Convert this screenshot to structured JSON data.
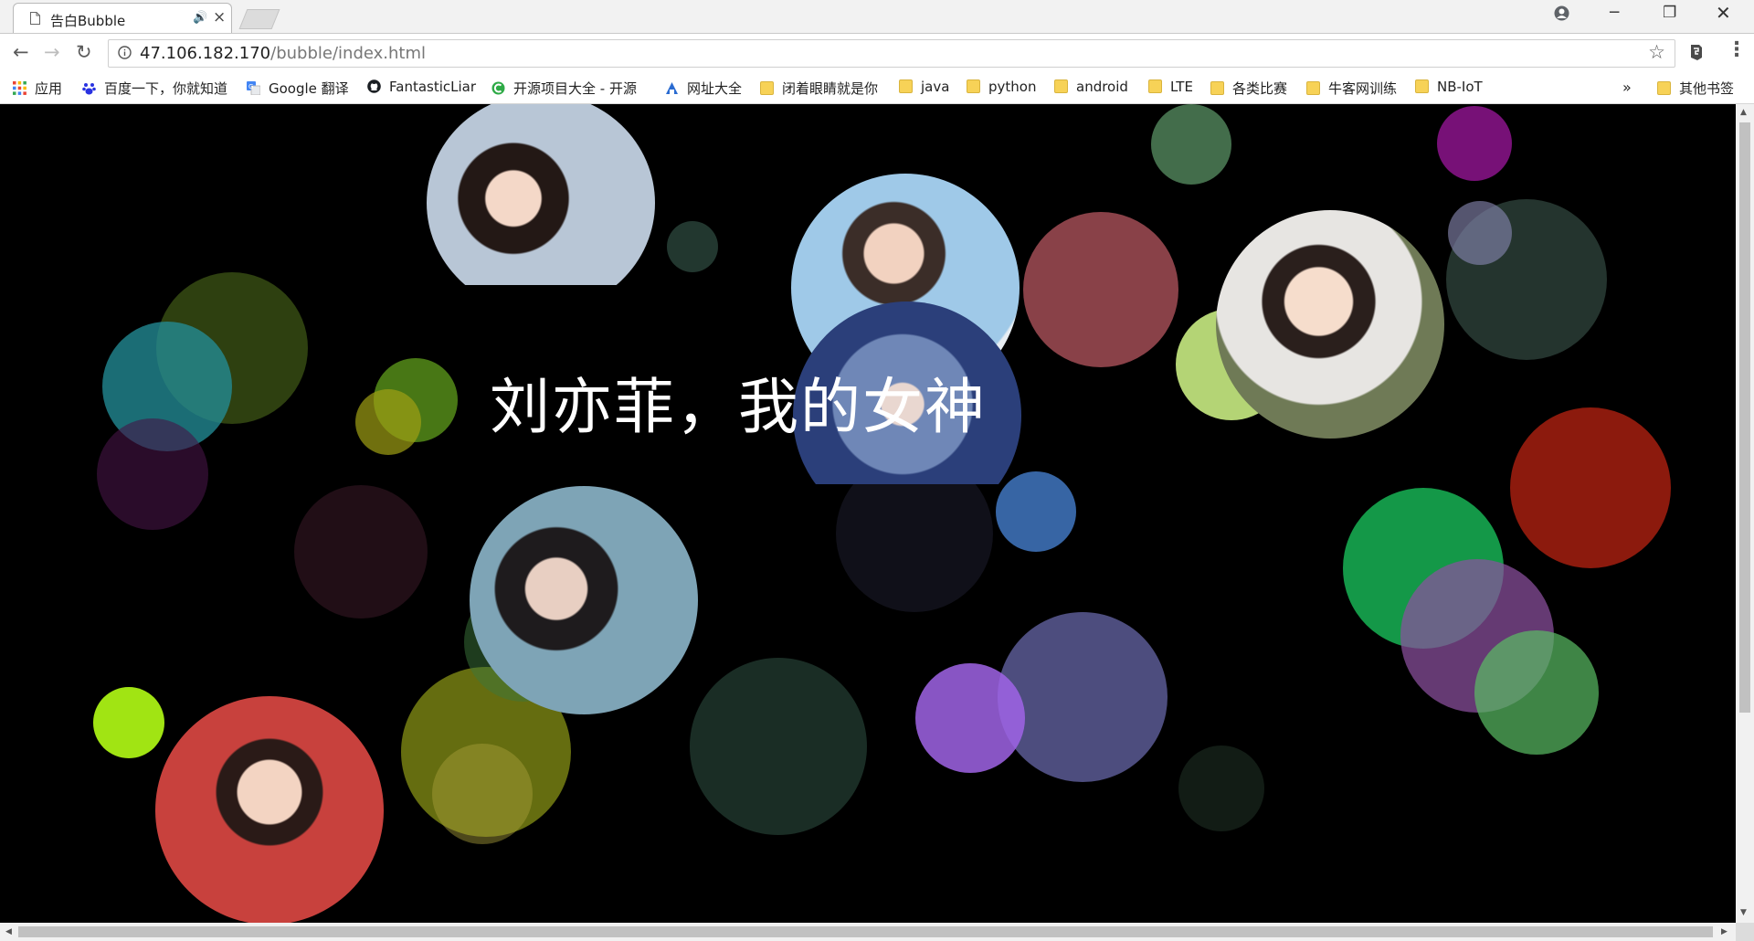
{
  "tab": {
    "title": "告白Bubble"
  },
  "address": {
    "host": "47.106.182.170",
    "path": "/bubble/index.html"
  },
  "bookmarks": [
    {
      "label": "应用",
      "icon": "apps-grid-icon"
    },
    {
      "label": "百度一下，你就知道",
      "icon": "baidu-paw-icon"
    },
    {
      "label": "Google 翻译",
      "icon": "google-translate-icon"
    },
    {
      "label": "FantasticLiar",
      "icon": "github-icon"
    },
    {
      "label": "开源项目大全 - 开源",
      "icon": "oschina-icon"
    },
    {
      "label": "网址大全",
      "icon": "hao123-icon"
    },
    {
      "label": "闭着眼睛就是你",
      "icon": "folder-icon"
    },
    {
      "label": "java",
      "icon": "folder-icon"
    },
    {
      "label": "python",
      "icon": "folder-icon"
    },
    {
      "label": "android",
      "icon": "folder-icon"
    },
    {
      "label": "LTE",
      "icon": "folder-icon"
    },
    {
      "label": "各类比赛",
      "icon": "folder-icon"
    },
    {
      "label": "牛客网训练",
      "icon": "folder-icon"
    },
    {
      "label": "NB-IoT",
      "icon": "folder-icon"
    }
  ],
  "bookmarks_overflow": "»",
  "other_bookmarks": "其他书签",
  "page": {
    "headline": "刘亦菲，我的女神"
  },
  "colors": {
    "background": "#000000",
    "headline": "#ffffff"
  }
}
